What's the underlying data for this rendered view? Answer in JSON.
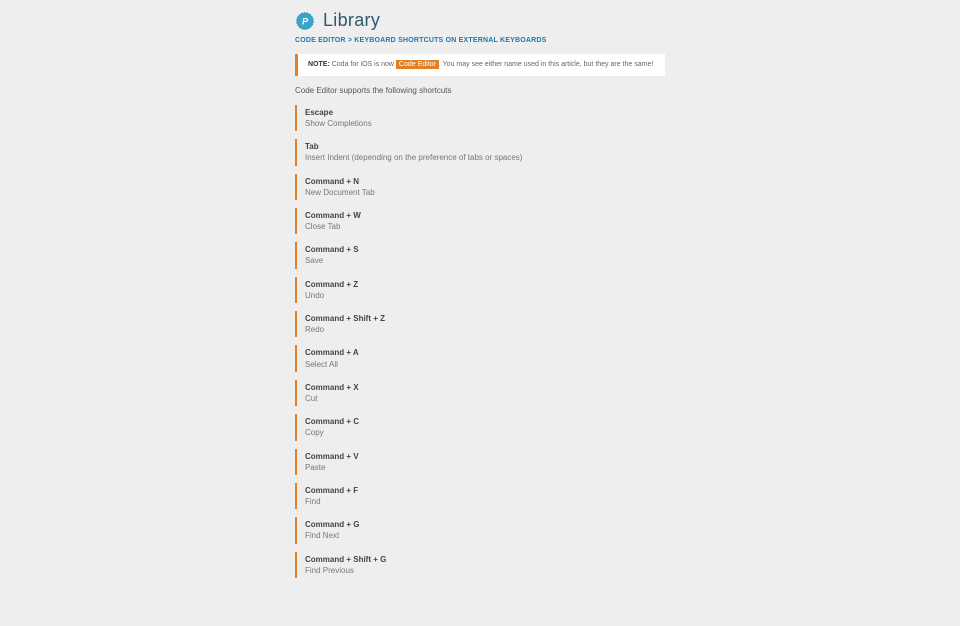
{
  "header": {
    "title": "Library"
  },
  "breadcrumb": {
    "part1": "CODE EDITOR",
    "sep": " > ",
    "part2": "KEYBOARD SHORTCUTS ON EXTERNAL KEYBOARDS"
  },
  "note": {
    "label": "NOTE:",
    "before": " Coda for iOS is now ",
    "highlight": "Code Editor",
    "after": ". You may see either name used in this article, but they are the same!"
  },
  "intro": "Code Editor supports the following shortcuts",
  "shortcuts": [
    {
      "keys": "Escape",
      "desc": "Show Completions"
    },
    {
      "keys": "Tab",
      "desc": "Insert Indent (depending on the preference of tabs or spaces)"
    },
    {
      "keys": "Command + N",
      "desc": "New Document Tab"
    },
    {
      "keys": "Command + W",
      "desc": "Close Tab"
    },
    {
      "keys": "Command + S",
      "desc": "Save"
    },
    {
      "keys": "Command + Z",
      "desc": "Undo"
    },
    {
      "keys": "Command + Shift + Z",
      "desc": "Redo"
    },
    {
      "keys": "Command + A",
      "desc": "Select All"
    },
    {
      "keys": "Command + X",
      "desc": "Cut"
    },
    {
      "keys": "Command + C",
      "desc": "Copy"
    },
    {
      "keys": "Command + V",
      "desc": "Paste"
    },
    {
      "keys": "Command + F",
      "desc": "Find"
    },
    {
      "keys": "Command + G",
      "desc": "Find Next"
    },
    {
      "keys": "Command + Shift + G",
      "desc": "Find Previous"
    }
  ]
}
